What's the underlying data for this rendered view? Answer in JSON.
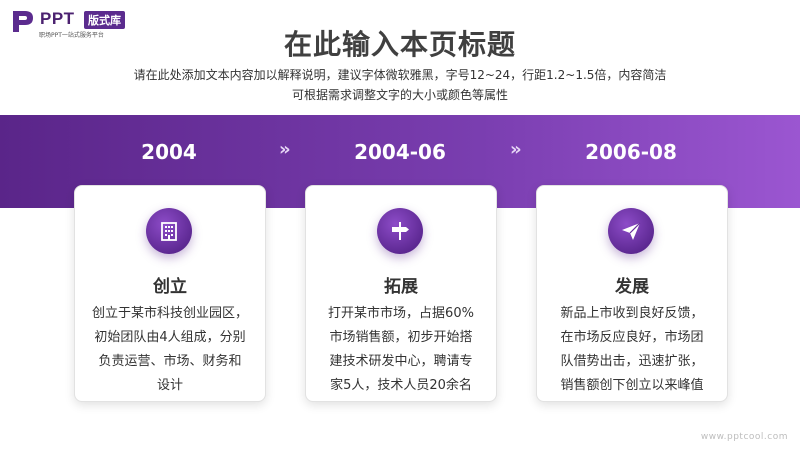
{
  "logo": {
    "name": "PPT",
    "badge": "版式库",
    "tagline": "职场PPT一站式服务平台"
  },
  "header": {
    "title": "在此输入本页标题",
    "subtitle_lines": [
      "请在此处添加文本内容加以解释说明，建议字体微软雅黑，字号12~24，行距1.2~1.5倍，内容简洁",
      "可根据需求调整文字的大小或颜色等属性"
    ]
  },
  "timeline": [
    {
      "year": "2004",
      "icon": "building-icon",
      "title": "创立",
      "body_lines": [
        "创立于某市科技创业园区，",
        "初始团队由4人组成，分别",
        "负责运营、市场、财务和",
        "设计"
      ]
    },
    {
      "year": "2004-06",
      "icon": "road-sign-icon",
      "title": "拓展",
      "body_lines": [
        "打开某市市场，占据60%",
        "市场销售额，初步开始搭",
        "建技术研发中心，聘请专",
        "家5人，技术人员20余名"
      ]
    },
    {
      "year": "2006-08",
      "icon": "paper-plane-icon",
      "title": "发展",
      "body_lines": [
        "新品上市收到良好反馈，",
        "在市场反应良好，市场团",
        "队借势出击，迅速扩张，",
        "销售额创下创立以来峰值"
      ]
    }
  ],
  "arrows": [
    "»",
    "»"
  ],
  "watermark": "www.pptcool.com",
  "colors": {
    "accent": "#6a2f9e",
    "band_start": "#5a2589",
    "band_end": "#9b56d1"
  }
}
